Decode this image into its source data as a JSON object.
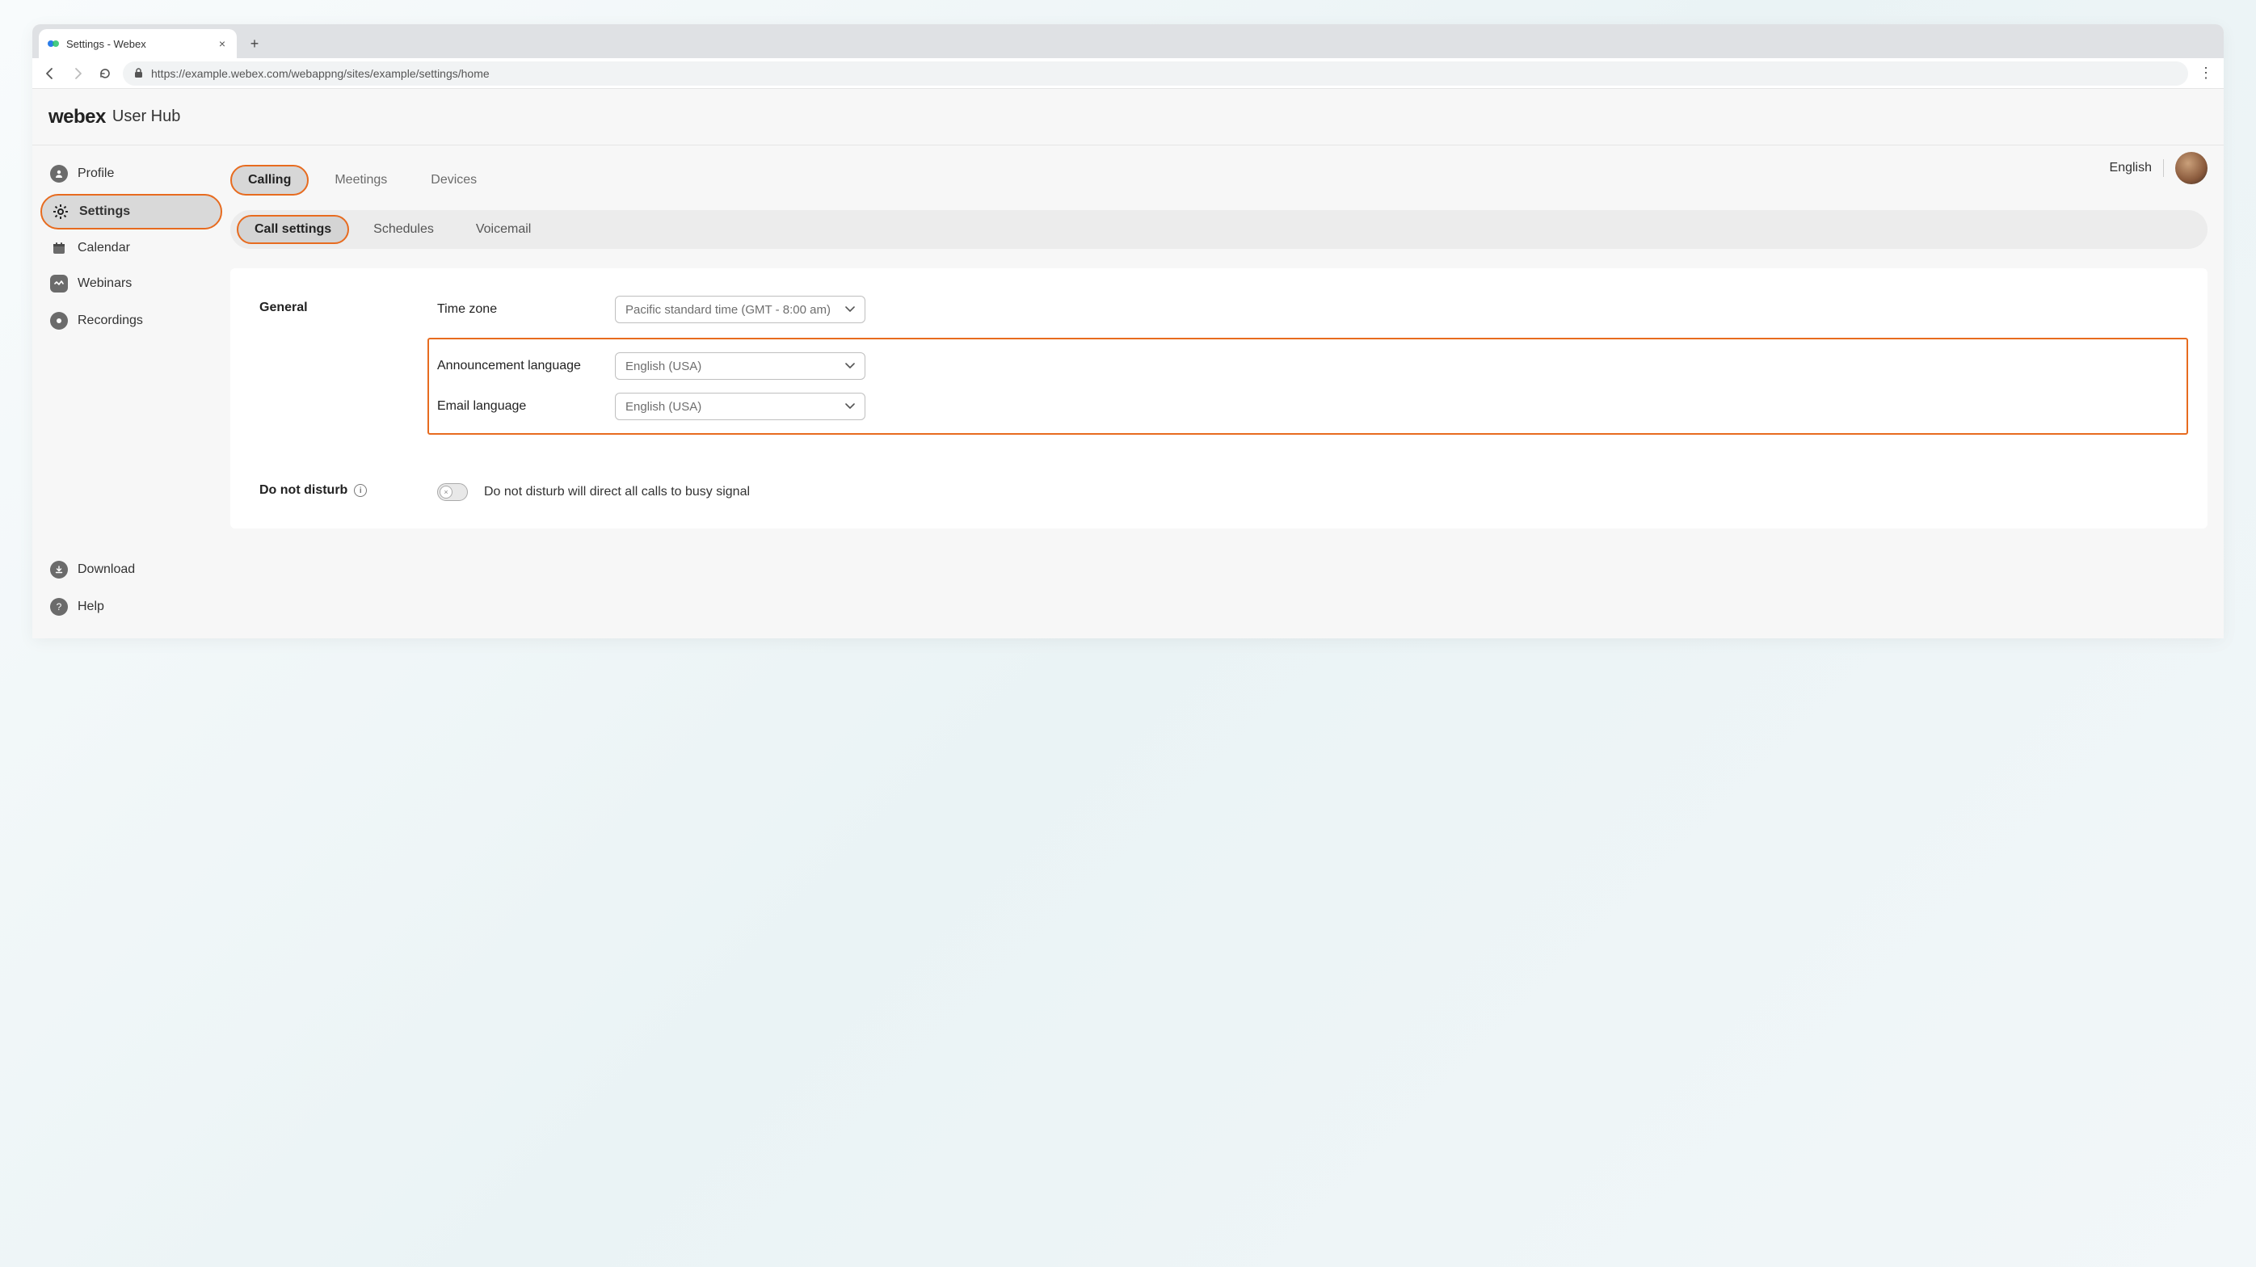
{
  "browser": {
    "tab_title": "Settings - Webex",
    "url": "https://example.webex.com/webappng/sites/example/settings/home"
  },
  "brand": {
    "name": "webex",
    "sub": "User Hub"
  },
  "header": {
    "language": "English"
  },
  "sidebar": {
    "items": [
      {
        "label": "Profile"
      },
      {
        "label": "Settings"
      },
      {
        "label": "Calendar"
      },
      {
        "label": "Webinars"
      },
      {
        "label": "Recordings"
      }
    ],
    "footer": [
      {
        "label": "Download"
      },
      {
        "label": "Help"
      }
    ]
  },
  "tabs": {
    "primary": [
      {
        "label": "Calling"
      },
      {
        "label": "Meetings"
      },
      {
        "label": "Devices"
      }
    ],
    "nested": [
      {
        "label": "Call settings"
      },
      {
        "label": "Schedules"
      },
      {
        "label": "Voicemail"
      }
    ]
  },
  "general": {
    "title": "General",
    "timezone_label": "Time zone",
    "timezone_value": "Pacific standard time (GMT - 8:00 am)",
    "announcement_label": "Announcement language",
    "announcement_value": "English (USA)",
    "email_label": "Email language",
    "email_value": "English (USA)"
  },
  "dnd": {
    "title": "Do not disturb",
    "description": "Do not disturb will direct all calls to busy signal"
  }
}
